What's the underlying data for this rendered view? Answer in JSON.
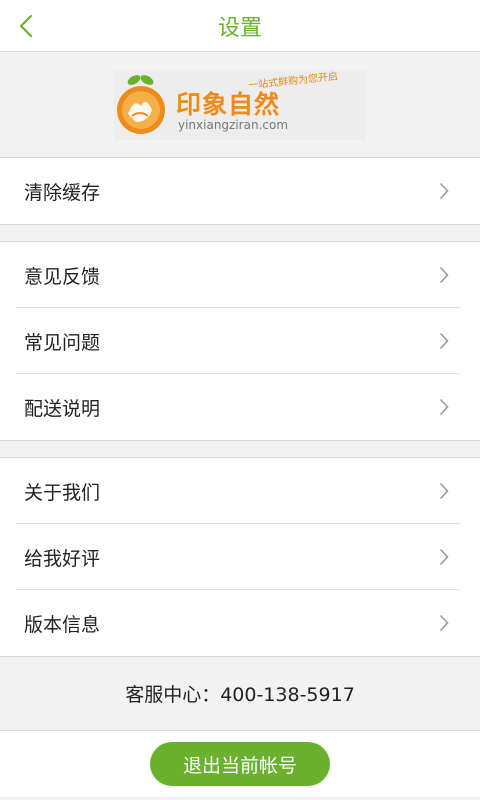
{
  "header": {
    "title": "设置",
    "back_icon": "chevron-left-icon",
    "accent_color": "#6ab22e"
  },
  "logo": {
    "name_cn": "印象自然",
    "slogan": "一站式鲜购为您开启",
    "domain": "yinxiangziran.com",
    "brand_color": "#ef8a1c"
  },
  "groups": [
    {
      "items": [
        {
          "label": "清除缓存"
        }
      ]
    },
    {
      "items": [
        {
          "label": "意见反馈"
        },
        {
          "label": "常见问题"
        },
        {
          "label": "配送说明"
        }
      ]
    },
    {
      "items": [
        {
          "label": "关于我们"
        },
        {
          "label": "给我好评"
        },
        {
          "label": "版本信息"
        }
      ]
    }
  ],
  "service": {
    "text": "客服中心：400-138-5917"
  },
  "logout": {
    "label": "退出当前帐号",
    "color": "#6ab22e"
  }
}
